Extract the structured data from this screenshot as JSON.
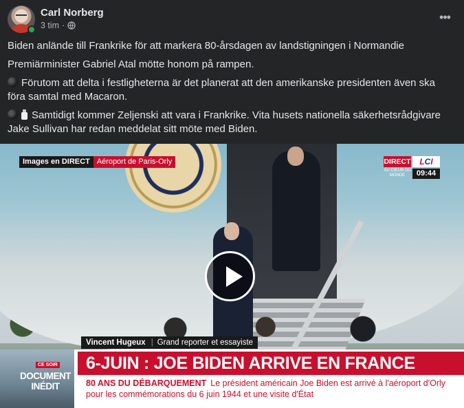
{
  "post": {
    "author": "Carl Norberg",
    "time": "3 tim",
    "separator": "·",
    "audience_icon": "globe-icon",
    "more_label": "•••",
    "paragraphs": [
      "Biden anlände till Frankrike för att markera 80-årsdagen av landstigningen i Normandie",
      "Premiärminister Gabriel Atal mötte honom på rampen.",
      "Förutom att delta i festligheterna är det planerat att den amerikanske presidenten även ska föra samtal med Macaron.",
      "Samtidigt kommer Zeljenski att vara i Frankrike. Vita husets nationella säkerhetsrådgivare Jake Sullivan har redan meddelat sitt möte med Biden."
    ],
    "colors": {
      "background": "#242526",
      "text": "#e4e6eb",
      "muted": "#b0b3b8",
      "online": "#31a24c"
    }
  },
  "video": {
    "overlay_left": "Images en DIRECT",
    "overlay_location": "Aéroport de Paris-Orly",
    "channel_direct": "DIRECT",
    "channel_logo_l": "L",
    "channel_logo_c": "C",
    "channel_logo_i": "I",
    "channel_coeur": "AU CŒUR DU MONDE",
    "channel_time": "09:44",
    "play_icon": "play-icon",
    "speaker_name": "Vincent Hugeux",
    "speaker_title": "Grand reporter et essayiste",
    "doc_soir": "CE SOIR",
    "doc_title": "DOCUMENT INÉDIT",
    "headline": "6-JUIN : JOE BIDEN ARRIVE EN FRANCE",
    "sub_label": "80 ANS DU DÉBARQUEMENT",
    "sub_text": "Le président américain Joe Biden est arrivé à l'aéroport d'Orly pour les commémorations du 6 juin 1944 et une visite d'État",
    "colors": {
      "lci_red": "#c8102e",
      "lci_blue": "#0b3e91"
    }
  }
}
